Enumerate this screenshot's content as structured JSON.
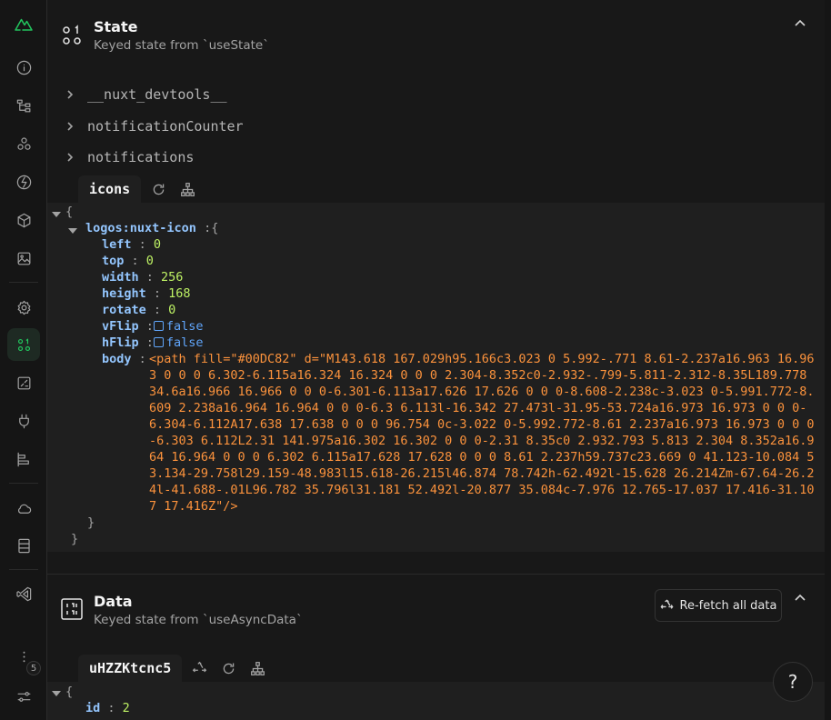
{
  "sidebar": {
    "logo": "nuxt-logo-icon",
    "items": [
      {
        "icon": "info-icon"
      },
      {
        "icon": "components-tree-icon"
      },
      {
        "icon": "modules-icon"
      },
      {
        "icon": "hooks-icon"
      },
      {
        "icon": "assets-cube-icon"
      },
      {
        "icon": "image-icon"
      },
      {
        "icon": "settings-icon"
      },
      {
        "icon": "state-icon",
        "active": true
      },
      {
        "icon": "server-routes-icon"
      },
      {
        "icon": "plugin-icon"
      },
      {
        "icon": "timeline-icon"
      },
      {
        "icon": "cloud-icon"
      },
      {
        "icon": "storage-icon"
      },
      {
        "icon": "vscode-icon"
      },
      {
        "icon": "more-icon"
      },
      {
        "icon": "preferences-icon"
      }
    ],
    "badge": "5"
  },
  "state_section": {
    "title": "State",
    "description": "Keyed state from `useState`",
    "keys": [
      "__nuxt_devtools__",
      "notificationCounter",
      "notifications"
    ],
    "active_key": "icons",
    "code": {
      "open_brace": "{",
      "close_brace": "}",
      "inner_key": "logos:nuxt-icon",
      "colon_brace": ":{",
      "props": [
        {
          "key": "left",
          "value": "0"
        },
        {
          "key": "top",
          "value": "0"
        },
        {
          "key": "width",
          "value": "256"
        },
        {
          "key": "height",
          "value": "168"
        },
        {
          "key": "rotate",
          "value": "0"
        }
      ],
      "vflip_key": "vFlip",
      "vflip_value": "false",
      "hflip_key": "hFlip",
      "hflip_value": "false",
      "body_key": "body",
      "body_value": "<path fill=\"#00DC82\" d=\"M143.618 167.029h95.166c3.023 0 5.992-.771 8.61-2.237a16.963 16.963 0 0 0 6.302-6.115a16.324 16.324 0 0 0 2.304-8.352c0-2.932-.799-5.811-2.312-8.35L189.778 34.6a16.966 16.966 0 0 0-6.301-6.113a17.626 17.626 0 0 0-8.608-2.238c-3.023 0-5.991.772-8.609 2.238a16.964 16.964 0 0 0-6.3 6.113l-16.342 27.473l-31.95-53.724a16.973 16.973 0 0 0-6.304-6.112A17.638 17.638 0 0 0 96.754 0c-3.022 0-5.992.772-8.61 2.237a16.973 16.973 0 0 0-6.303 6.112L2.31 141.975a16.302 16.302 0 0 0-2.31 8.35c0 2.932.793 5.813 2.304 8.352a16.964 16.964 0 0 0 6.302 6.115a17.628 17.628 0 0 0 8.61 2.237h59.737c23.669 0 41.123-10.084 53.134-29.758l29.159-48.983l15.618-26.215l46.874 78.742h-62.492l-15.628 26.214Zm-67.64-26.24l-41.688-.01L96.782 35.796l31.181 52.492l-20.877 35.084c-7.976 12.765-17.037 17.416-31.107 17.416Z\"/>"
    }
  },
  "data_section": {
    "title": "Data",
    "description": "Keyed state from `useAsyncData`",
    "refetch_label": "Re-fetch all data",
    "active_key": "uHZZKtcnc5",
    "code": {
      "open_brace": "{",
      "id_key": "id",
      "id_value": "2"
    }
  },
  "help_label": "?"
}
